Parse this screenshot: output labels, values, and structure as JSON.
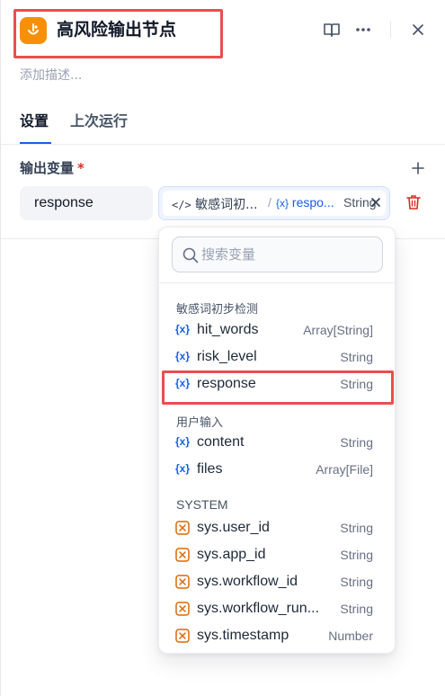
{
  "node": {
    "title": "高风险输出节点",
    "description_placeholder": "添加描述..."
  },
  "tabs": [
    {
      "label": "设置",
      "active": true
    },
    {
      "label": "上次运行",
      "active": false
    }
  ],
  "output": {
    "section_label": "输出变量",
    "required_mark": "*",
    "variable_name": "response",
    "reference": {
      "node": "敏感词初...",
      "separator": "/",
      "variable": "respo...",
      "type": "String"
    }
  },
  "dropdown": {
    "search_placeholder": "搜索变量",
    "groups": [
      {
        "title": "敏感词初步检测",
        "items": [
          {
            "name": "hit_words",
            "type": "Array[String]"
          },
          {
            "name": "risk_level",
            "type": "String"
          },
          {
            "name": "response",
            "type": "String"
          }
        ]
      },
      {
        "title": "用户输入",
        "items": [
          {
            "name": "content",
            "type": "String"
          },
          {
            "name": "files",
            "type": "Array[File]"
          }
        ]
      },
      {
        "title": "SYSTEM",
        "items": [
          {
            "name": "sys.user_id",
            "type": "String"
          },
          {
            "name": "sys.app_id",
            "type": "String"
          },
          {
            "name": "sys.workflow_id",
            "type": "String"
          },
          {
            "name": "sys.workflow_run...",
            "type": "String"
          },
          {
            "name": "sys.timestamp",
            "type": "Number"
          }
        ]
      }
    ]
  },
  "colors": {
    "accent": "#155eef",
    "node_icon": "#f79009",
    "system_var": "#dc6803",
    "danger": "#d92d20",
    "highlight": "#ea4e4e"
  },
  "icons": {
    "node": "llm-output-icon",
    "docs": "book-icon",
    "more": "more-dots-icon",
    "close": "close-icon",
    "add": "plus-icon",
    "delete": "trash-icon",
    "var": "variable-brace-icon",
    "sys": "system-variable-icon",
    "search": "search-icon"
  }
}
